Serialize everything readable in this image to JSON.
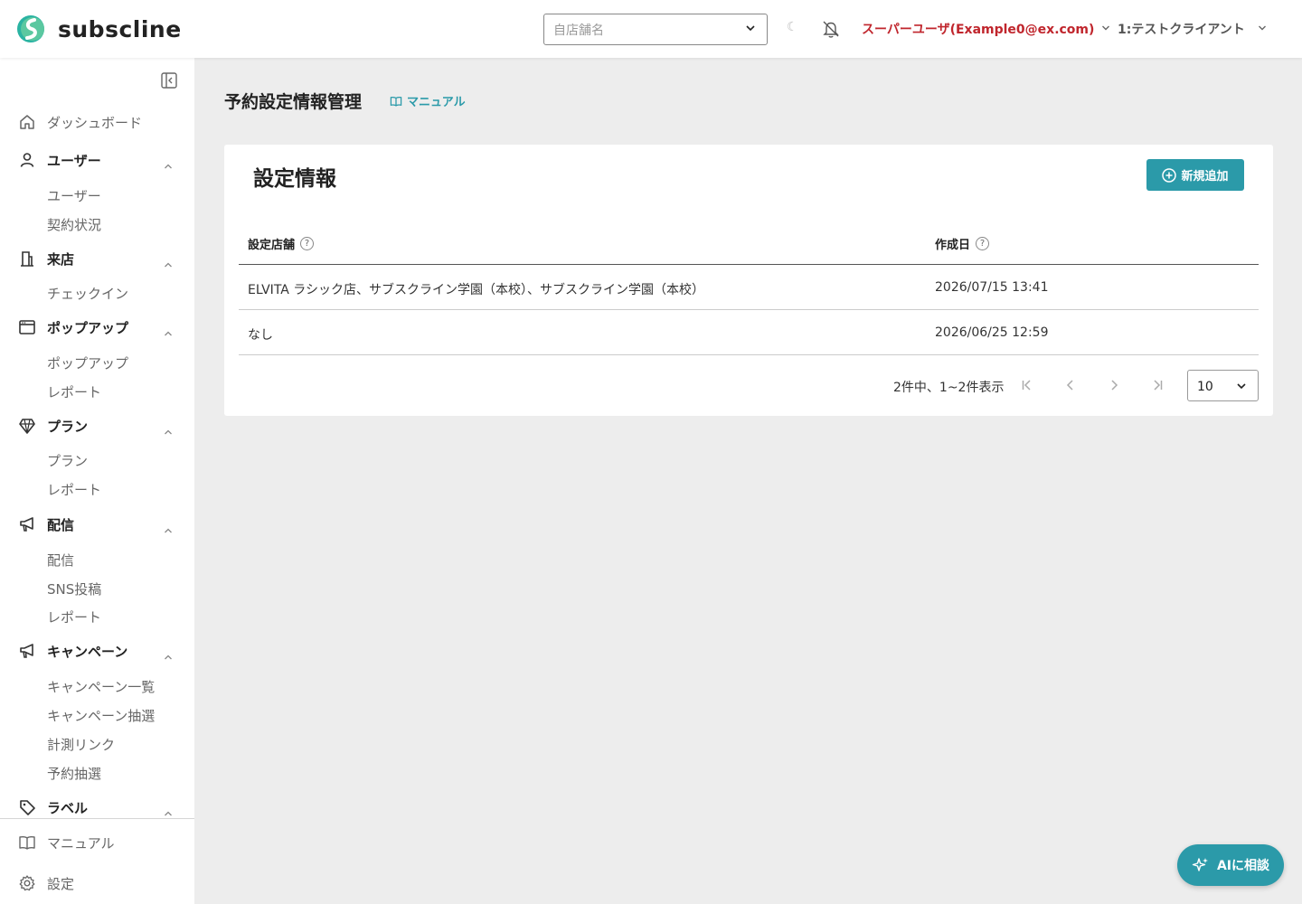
{
  "header": {
    "logo_text": "subscline",
    "store_select_placeholder": "自店舗名",
    "theme_glyph": "☾",
    "user_label": "スーパーユーザ(Example0@ex.com)",
    "client_label": "1:テストクライアント"
  },
  "sidebar": {
    "sections": [
      {
        "label": "ダッシュボード",
        "icon": "home-icon",
        "items": []
      },
      {
        "label": "ユーザー",
        "icon": "user-icon",
        "items": [
          "ユーザー",
          "契約状況"
        ]
      },
      {
        "label": "来店",
        "icon": "building-icon",
        "items": [
          "チェックイン"
        ]
      },
      {
        "label": "ポップアップ",
        "icon": "window-icon",
        "items": [
          "ポップアップ",
          "レポート"
        ]
      },
      {
        "label": "プラン",
        "icon": "diamond-icon",
        "items": [
          "プラン",
          "レポート"
        ]
      },
      {
        "label": "配信",
        "icon": "megaphone-icon",
        "items": [
          "配信",
          "SNS投稿",
          "レポート"
        ]
      },
      {
        "label": "キャンペーン",
        "icon": "megaphone-icon",
        "items": [
          "キャンペーン一覧",
          "キャンペーン抽選",
          "計測リンク",
          "予約抽選"
        ]
      },
      {
        "label": "ラベル",
        "icon": "tag-icon",
        "items": []
      }
    ],
    "bottom": [
      {
        "label": "マニュアル",
        "icon": "book-icon"
      },
      {
        "label": "設定",
        "icon": "gear-icon"
      }
    ]
  },
  "main": {
    "page_title": "予約設定情報管理",
    "manual_link": "マニュアル",
    "card_title": "設定情報",
    "add_button": "新規追加",
    "help_glyph": "?",
    "table": {
      "columns": [
        "設定店舗",
        "作成日"
      ],
      "rows": [
        [
          "ELVITA ラシック店、サブスクライン学園（本校）、サブスクライン学園（本校）",
          "2026/07/15 13:41"
        ],
        [
          "なし",
          "2026/06/25 12:59"
        ]
      ]
    },
    "pagination": {
      "summary": "2件中、1~2件表示",
      "per_page": "10"
    }
  },
  "ai_button": "AIに相談",
  "colors": {
    "accent": "#2b9aa9",
    "user_red": "#c0262d",
    "background": "#ededed"
  }
}
